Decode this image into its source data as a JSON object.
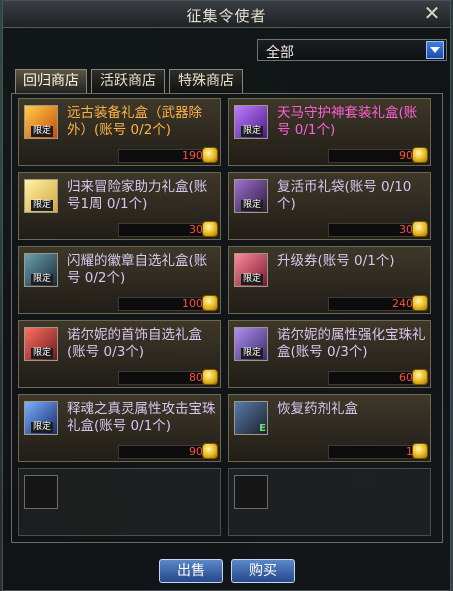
{
  "window": {
    "title": "征集令使者",
    "close_glyph": "✕"
  },
  "filter": {
    "selected": "全部"
  },
  "tabs": [
    {
      "label": "回归商店",
      "active": true
    },
    {
      "label": "活跃商店",
      "active": false
    },
    {
      "label": "特殊商店",
      "active": false
    }
  ],
  "items": [
    {
      "name": "远古装备礼盒（武器除外）(账号 0/2个)",
      "price": "190",
      "badge": "限定",
      "icon": "orange-chest-icon",
      "color": "orange"
    },
    {
      "name": "天马守护神套装礼盒(账号 0/1个)",
      "price": "90",
      "badge": "限定",
      "icon": "purple-chest-icon",
      "color": "pink"
    },
    {
      "name": "归来冒险家助力礼盒(账号1周 0/1个)",
      "price": "30",
      "badge": "限定",
      "icon": "gift-box-icon",
      "color": "lavender"
    },
    {
      "name": "复活币礼袋(账号 0/10个)",
      "price": "30",
      "badge": "限定",
      "icon": "coin-bag-icon",
      "color": "lavender"
    },
    {
      "name": "闪耀的徽章自选礼盒(账号 0/2个)",
      "price": "100",
      "badge": "限定",
      "icon": "emblem-box-icon",
      "color": "lavender"
    },
    {
      "name": "升级券(账号 0/1个)",
      "price": "240",
      "badge": "限定",
      "icon": "ticket-icon",
      "color": "lavender"
    },
    {
      "name": "诺尔妮的首饰自选礼盒(账号 0/3个)",
      "price": "80",
      "badge": "限定",
      "icon": "jewelry-box-icon",
      "color": "lavender"
    },
    {
      "name": "诺尔妮的属性强化宝珠礼盒(账号 0/3个)",
      "price": "60",
      "badge": "限定",
      "icon": "orb-box-icon",
      "color": "lavender"
    },
    {
      "name": "释魂之真灵属性攻击宝珠礼盒(账号 0/1个)",
      "price": "90",
      "badge": "限定",
      "icon": "blue-chest-icon",
      "color": "lavender"
    },
    {
      "name": "恢复药剂礼盒",
      "price": "1",
      "badge": "",
      "mark": "E",
      "icon": "potion-box-icon",
      "color": "lavender"
    }
  ],
  "buttons": {
    "sell": "出售",
    "buy": "购买"
  },
  "colors": {
    "accent": "#3f7de0",
    "price": "#ff4e3a",
    "item_text": "#d7c7ef"
  }
}
